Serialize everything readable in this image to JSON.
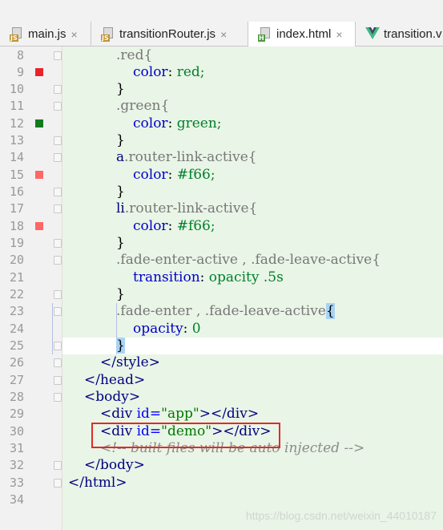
{
  "tabs": [
    {
      "label": "main.js",
      "icon": "js-file-icon",
      "active": false
    },
    {
      "label": "transitionRouter.js",
      "icon": "js-file-icon",
      "active": false
    },
    {
      "label": "index.html",
      "icon": "html-file-icon",
      "active": true
    },
    {
      "label": "transition.v",
      "icon": "vue-file-icon",
      "active": false
    }
  ],
  "close_glyph": "×",
  "lines": [
    {
      "n": "8"
    },
    {
      "n": "9"
    },
    {
      "n": "10"
    },
    {
      "n": "11"
    },
    {
      "n": "12"
    },
    {
      "n": "13"
    },
    {
      "n": "14"
    },
    {
      "n": "15"
    },
    {
      "n": "16"
    },
    {
      "n": "17"
    },
    {
      "n": "18"
    },
    {
      "n": "19"
    },
    {
      "n": "20"
    },
    {
      "n": "21"
    },
    {
      "n": "22"
    },
    {
      "n": "23"
    },
    {
      "n": "24"
    },
    {
      "n": "25"
    },
    {
      "n": "26"
    },
    {
      "n": "27"
    },
    {
      "n": "28"
    },
    {
      "n": "29"
    },
    {
      "n": "30"
    },
    {
      "n": "31"
    },
    {
      "n": "32"
    },
    {
      "n": "33"
    },
    {
      "n": "34"
    }
  ],
  "code": {
    "l8_sel": ".red{",
    "l9_prop": "color",
    "l9_val": "red;",
    "l10": "}",
    "l11_sel": ".green{",
    "l12_prop": "color",
    "l12_val": "green;",
    "l13": "}",
    "l14_tag": "a",
    "l14_sel": ".router-link-active{",
    "l15_prop": "color",
    "l15_val": "#f66;",
    "l16": "}",
    "l17_tag": "li",
    "l17_sel": ".router-link-active{",
    "l18_prop": "color",
    "l18_val": "#f66;",
    "l19": "}",
    "l20_sel": ".fade-enter-active , .fade-leave-active{",
    "l21_prop": "transition",
    "l21_val1": "opacity",
    "l21_val2": ".5s",
    "l22": "}",
    "l23_sel": ".fade-enter , .fade-leave-active",
    "l23_brace": "{",
    "l24_prop": "opacity",
    "l24_val": "0",
    "l25": "}",
    "l26": "</style>",
    "l27": "</head>",
    "l28": "<body>",
    "l29_a": "<div ",
    "l29_attr": "id=",
    "l29_str": "\"app\"",
    "l29_b": "></div>",
    "l30_a": "<div ",
    "l30_attr": "id=",
    "l30_str": "\"demo\"",
    "l30_b": "></div>",
    "l31": "<!-- built files will be auto injected -->",
    "l32": "</body>",
    "l33": "</html>"
  },
  "markers": {
    "line9": "#e8242a",
    "line12": "#137a1e",
    "line15": "#ff6666",
    "line18": "#ff6666"
  },
  "watermark": "https://blog.csdn.net/weixin_44010187"
}
